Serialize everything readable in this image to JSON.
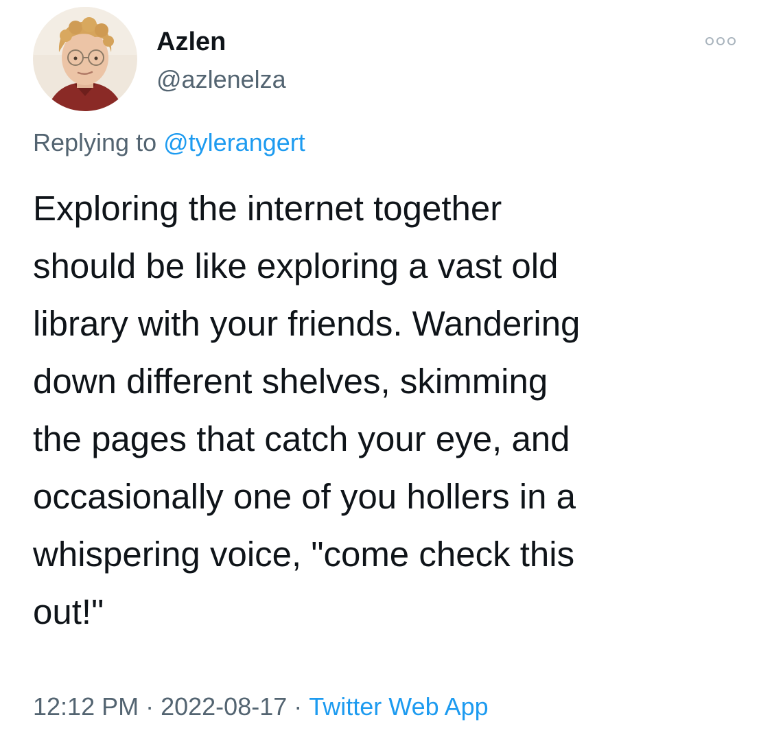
{
  "author": {
    "display_name": "Azlen",
    "handle": "@azlenelza"
  },
  "reply": {
    "prefix": "Replying to",
    "mention": "@tylerangert"
  },
  "tweet": {
    "lines": [
      "Exploring the internet together",
      "should be like exploring a vast old",
      "library with your friends. Wandering",
      "down different shelves, skimming",
      "the pages that catch your eye, and",
      "occasionally one of you hollers in a",
      "whispering voice, \"come check this",
      "out!\""
    ]
  },
  "meta": {
    "time": "12:12 PM",
    "separator": "·",
    "date": "2022-08-17",
    "source": "Twitter Web App"
  },
  "icons": {
    "more": "more-horizontal-icon"
  },
  "colors": {
    "text": "#0f1419",
    "secondary": "#536471",
    "link": "#1d9bf0",
    "background": "#ffffff"
  }
}
